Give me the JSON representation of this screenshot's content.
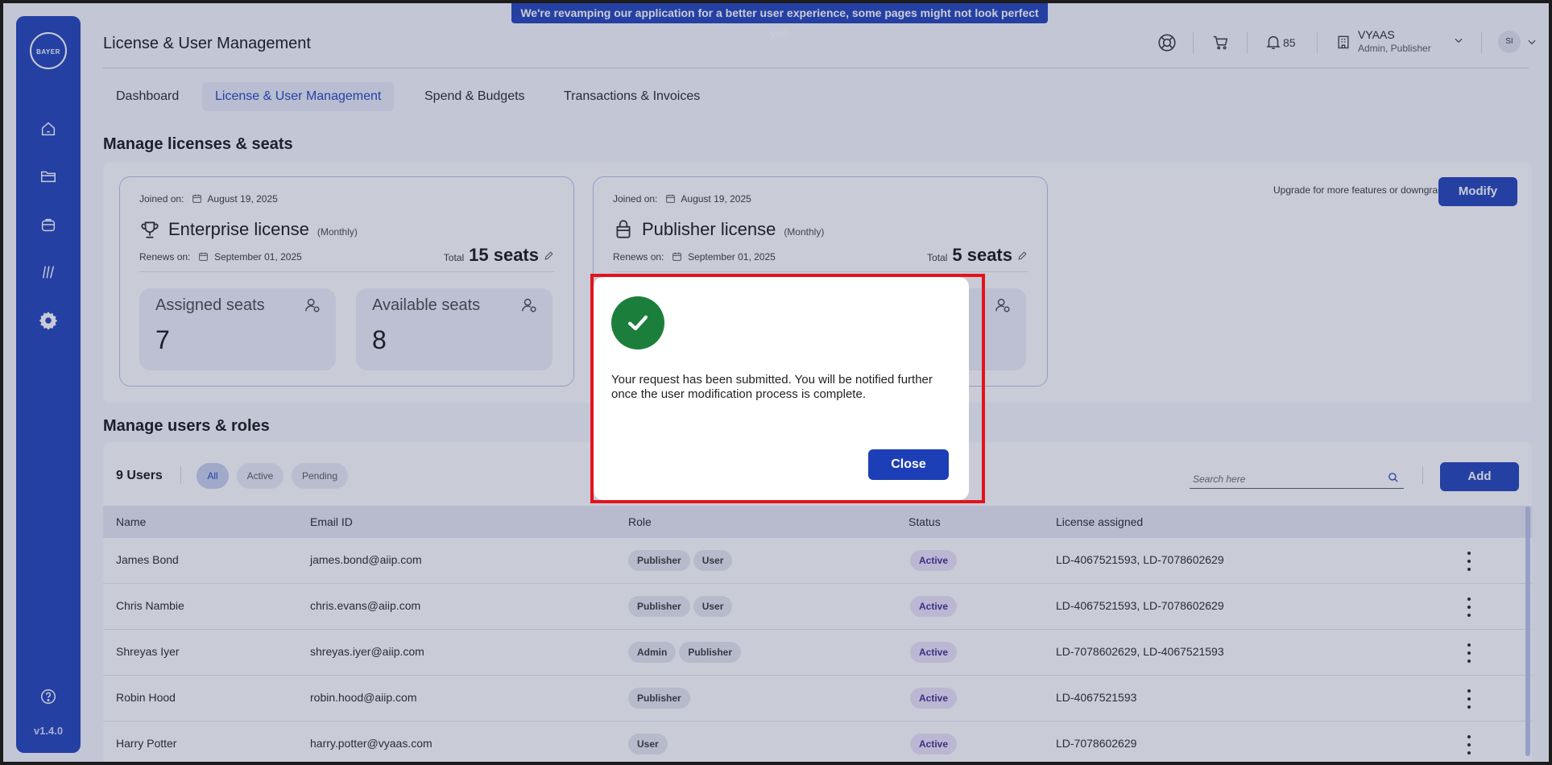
{
  "banner": "We're revamping our application for a better user experience, some pages might not look perfect yet!",
  "sidebar": {
    "logo_text": "BAYER",
    "version": "v1.4.0",
    "items": [
      "home-icon",
      "folder-icon",
      "bag-icon",
      "library-icon",
      "settings-icon"
    ],
    "help": "help-icon"
  },
  "header": {
    "title": "License & User Management",
    "notifications": "85",
    "org_name": "VYAAS",
    "org_role": "Admin, Publisher",
    "avatar_initials": "SI"
  },
  "tabs": [
    "Dashboard",
    "License & User Management",
    "Spend & Budgets",
    "Transactions & Invoices"
  ],
  "licenses": {
    "title": "Manage licenses & seats",
    "upgrade_text": "Upgrade for more features or downgrade anytime!",
    "modify_label": "Modify",
    "cards": [
      {
        "joined_label": "Joined on:",
        "joined_date": "August 19, 2025",
        "name": "Enterprise license",
        "period": "(Monthly)",
        "renews_label": "Renews on:",
        "renews_date": "September 01, 2025",
        "total_label": "Total",
        "total_seats": "15 seats",
        "assigned_label": "Assigned seats",
        "assigned_value": "7",
        "available_label": "Available seats",
        "available_value": "8"
      },
      {
        "joined_label": "Joined on:",
        "joined_date": "August 19, 2025",
        "name": "Publisher license",
        "period": "(Monthly)",
        "renews_label": "Renews on:",
        "renews_date": "September 01, 2025",
        "total_label": "Total",
        "total_seats": "5 seats"
      }
    ]
  },
  "users": {
    "title": "Manage users & roles",
    "count": "9 Users",
    "filters": [
      "All",
      "Active",
      "Pending"
    ],
    "search_placeholder": "Search here",
    "add_label": "Add",
    "columns": [
      "Name",
      "Email ID",
      "Role",
      "Status",
      "License assigned"
    ],
    "rows": [
      {
        "name": "James Bond",
        "email": "james.bond@aiip.com",
        "roles": [
          "Publisher",
          "User"
        ],
        "status": "Active",
        "license": "LD-4067521593, LD-7078602629"
      },
      {
        "name": "Chris Nambie",
        "email": "chris.evans@aiip.com",
        "roles": [
          "Publisher",
          "User"
        ],
        "status": "Active",
        "license": "LD-4067521593, LD-7078602629"
      },
      {
        "name": "Shreyas Iyer",
        "email": "shreyas.iyer@aiip.com",
        "roles": [
          "Admin",
          "Publisher"
        ],
        "status": "Active",
        "license": "LD-7078602629, LD-4067521593"
      },
      {
        "name": "Robin Hood",
        "email": "robin.hood@aiip.com",
        "roles": [
          "Publisher"
        ],
        "status": "Active",
        "license": "LD-4067521593"
      },
      {
        "name": "Harry Potter",
        "email": "harry.potter@vyaas.com",
        "roles": [
          "User"
        ],
        "status": "Active",
        "license": "LD-7078602629"
      }
    ]
  },
  "dialog": {
    "message": "Your request has been submitted. You will be notified further once the user modification process is complete.",
    "close_label": "Close"
  },
  "colors": {
    "primary": "#1c3fb7",
    "success": "#1b7f3b",
    "highlight": "#e3131b"
  }
}
